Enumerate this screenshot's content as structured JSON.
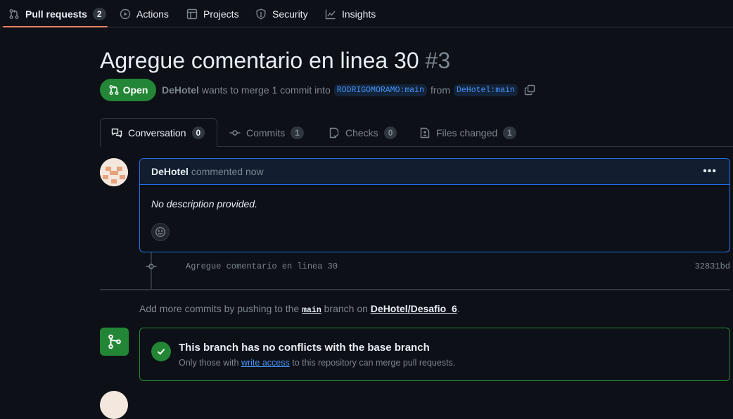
{
  "repo_nav": {
    "tabs": [
      {
        "label": "Pull requests",
        "count": "2",
        "icon": "git-pull-request-icon"
      },
      {
        "label": "Actions",
        "icon": "play-icon"
      },
      {
        "label": "Projects",
        "icon": "table-icon"
      },
      {
        "label": "Security",
        "icon": "shield-icon"
      },
      {
        "label": "Insights",
        "icon": "graph-icon"
      }
    ]
  },
  "pr": {
    "title": "Agregue comentario en linea 30",
    "number": "#3",
    "state": "Open",
    "author": "DeHotel",
    "merge_text": "wants to merge 1 commit into",
    "base_branch": "RODRIGOMORAMO:main",
    "from_text": "from",
    "head_branch": "DeHotel:main"
  },
  "pr_tabs": [
    {
      "label": "Conversation",
      "count": "0",
      "icon": "comment-discussion-icon"
    },
    {
      "label": "Commits",
      "count": "1",
      "icon": "git-commit-icon"
    },
    {
      "label": "Checks",
      "count": "0",
      "icon": "checklist-icon"
    },
    {
      "label": "Files changed",
      "count": "1",
      "icon": "file-diff-icon"
    }
  ],
  "comment": {
    "author": "DeHotel",
    "action": "commented now",
    "body": "No description provided."
  },
  "commit": {
    "message": "Agregue comentario en linea 30",
    "sha": "32831bd"
  },
  "hint": {
    "prefix": "Add more commits by pushing to the",
    "branch": "main",
    "middle": "branch on",
    "repo": "DeHotel/Desafio_6",
    "suffix": "."
  },
  "merge": {
    "title": "This branch has no conflicts with the base branch",
    "sub_prefix": "Only those with",
    "sub_link": "write access",
    "sub_suffix": "to this repository can merge pull requests."
  },
  "colors": {
    "background": "#0d1117",
    "border": "#30363d",
    "accent_green": "#238636",
    "accent_blue": "#1f6feb",
    "link": "#4493f8",
    "tab_underline": "#f78166"
  }
}
